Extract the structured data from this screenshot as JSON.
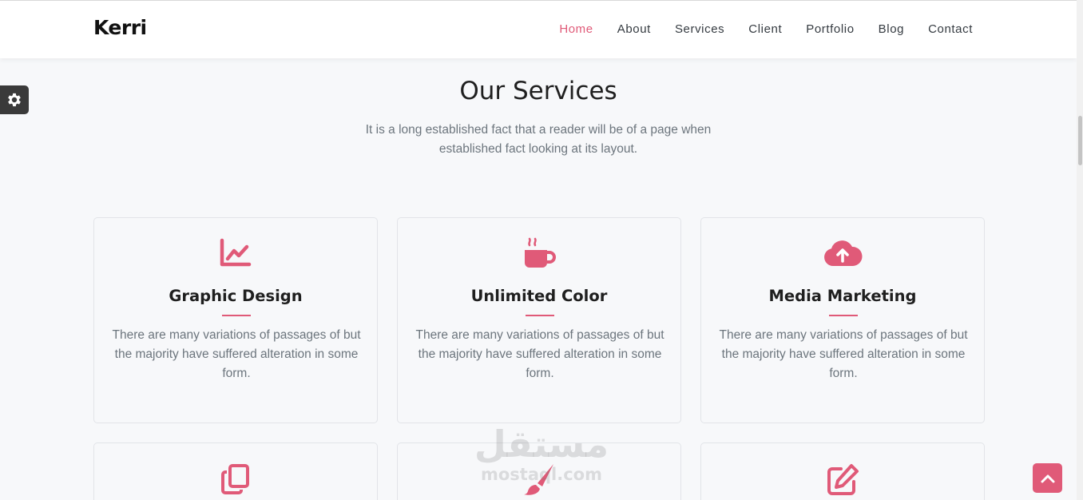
{
  "navbar": {
    "brand": "Kerri",
    "items": [
      {
        "label": "Home",
        "active": true
      },
      {
        "label": "About"
      },
      {
        "label": "Services"
      },
      {
        "label": "Client"
      },
      {
        "label": "Portfolio"
      },
      {
        "label": "Blog"
      },
      {
        "label": "Contact"
      }
    ]
  },
  "settings": {
    "icon": "gear-icon"
  },
  "services": {
    "title": "Our Services",
    "subtitle": "It is a long established fact that a reader will be of a page when established fact looking at its layout.",
    "cards": [
      {
        "icon": "line-chart-icon",
        "title": "Graphic Design",
        "text": "There are many variations of passages of but the majority have suffered alteration in some form."
      },
      {
        "icon": "coffee-cup-icon",
        "title": "Unlimited Color",
        "text": "There are many variations of passages of but the majority have suffered alteration in some form."
      },
      {
        "icon": "cloud-upload-icon",
        "title": "Media Marketing",
        "text": "There are many variations of passages of but the majority have suffered alteration in some form."
      },
      {
        "icon": "copy-icon"
      },
      {
        "icon": "paint-brush-icon"
      },
      {
        "icon": "edit-icon"
      }
    ]
  },
  "watermark": {
    "arabic": "مستقل",
    "latin": "mostaql.com"
  },
  "back_to_top": {
    "icon": "chevron-up-icon"
  },
  "colors": {
    "accent": "#e05a78",
    "background": "#f7f8fa",
    "heading": "#1f1f1f",
    "body_text": "#6c757d"
  }
}
